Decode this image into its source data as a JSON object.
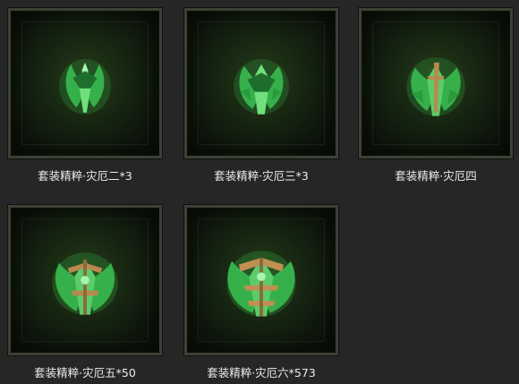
{
  "items": [
    {
      "label": "套装精粹·灾厄二*3",
      "icon": "green-curse-essence-icon",
      "tier": 2
    },
    {
      "label": "套装精粹·灾厄三*3",
      "icon": "green-curse-essence-icon",
      "tier": 3
    },
    {
      "label": "套装精粹·灾厄四",
      "icon": "green-curse-essence-icon",
      "tier": 4
    },
    {
      "label": "套装精粹·灾厄五*50",
      "icon": "green-curse-essence-icon",
      "tier": 5
    },
    {
      "label": "套装精粹·灾厄六*573",
      "icon": "green-curse-essence-icon",
      "tier": 6
    }
  ],
  "colors": {
    "background": "#262626",
    "frame": "#3d4134",
    "glow": "#4fd06a",
    "gold": "#b8894d",
    "label": "#ececec"
  }
}
